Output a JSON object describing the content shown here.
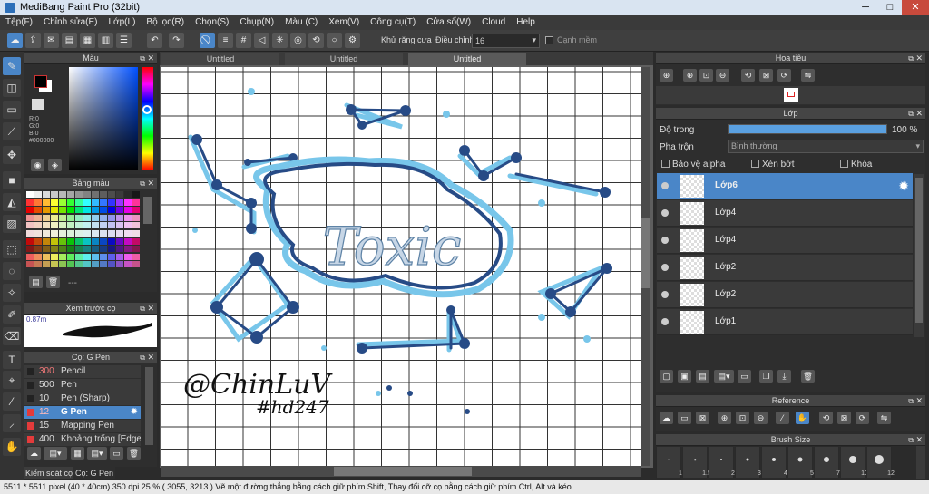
{
  "app": {
    "title": "MediBang Paint Pro (32bit)"
  },
  "menu": [
    "Tệp(F)",
    "Chỉnh sửa(E)",
    "Lớp(L)",
    "Bộ lọc(R)",
    "Chọn(S)",
    "Chụp(N)",
    "Màu (C)",
    "Xem(V)",
    "Công cụ(T)",
    "Cửa sổ(W)",
    "Cloud",
    "Help"
  ],
  "toolbar": {
    "antialias_label": "Khử răng cưa",
    "adjust_label": "Điều chỉnh",
    "adjust_value": "16",
    "sharpen_label": "Cạnh mềm"
  },
  "tabs": [
    "Untitled",
    "Untitled",
    "Untitled"
  ],
  "color_panel": {
    "title": "Màu",
    "r": "R:0",
    "g": "G:0",
    "b": "B:0",
    "hex": "#000000",
    "primary": "#000000",
    "secondary": "#ffffff"
  },
  "palette_panel": {
    "title": "Bảng màu",
    "more": "---"
  },
  "preview_panel": {
    "title": "Xem trước cọ",
    "size": "0.87m"
  },
  "brush_panel": {
    "title": "Cọ: G Pen",
    "items": [
      {
        "size": "300",
        "name": "Pencil",
        "color": "#222222"
      },
      {
        "size": "500",
        "name": "Pen",
        "color": "#222222"
      },
      {
        "size": "10",
        "name": "Pen (Sharp)",
        "color": "#222222"
      },
      {
        "size": "12",
        "name": "G Pen",
        "color": "#e43b3b"
      },
      {
        "size": "15",
        "name": "Mapping Pen",
        "color": "#e43b3b"
      },
      {
        "size": "400",
        "name": "Khoảng trống [Edge]",
        "color": "#e43b3b"
      }
    ]
  },
  "bottom_tabs": [
    "Kiểm soát cọ",
    "Cọ: G Pen"
  ],
  "navigator_panel": {
    "title": "Hoa tiêu"
  },
  "layer_panel": {
    "title": "Lớp",
    "opacity_label": "Độ trong",
    "opacity_value": "100 %",
    "opacity": 1.0,
    "blend_label": "Pha trộn",
    "blend_value": "Bình thường",
    "protect_alpha": "Bảo vệ alpha",
    "clipping": "Xén bớt",
    "lock": "Khóa",
    "layers": [
      "Lớp6",
      "Lớp4",
      "Lớp4",
      "Lớp2",
      "Lớp2",
      "Lớp1"
    ]
  },
  "reference_panel": {
    "title": "Reference"
  },
  "brushsize_panel": {
    "title": "Brush Size",
    "sizes": [
      "1",
      "1.5",
      "2",
      "3",
      "4",
      "5",
      "7",
      "10",
      "12"
    ]
  },
  "artwork": {
    "word": "Toxic",
    "signature": "@ChinLuV",
    "hashtag": "#hd247",
    "accent_light": "#78c6ea",
    "accent_dark": "#274b86"
  },
  "status": "5511 * 5511 pixel  (40 * 40cm)  350 dpi  25 %  ( 3055, 3213 )  Vẽ một đường thẳng bằng cách giữ phím Shift, Thay đổi cỡ cọ bằng cách giữ phím Ctrl, Alt và kéo"
}
